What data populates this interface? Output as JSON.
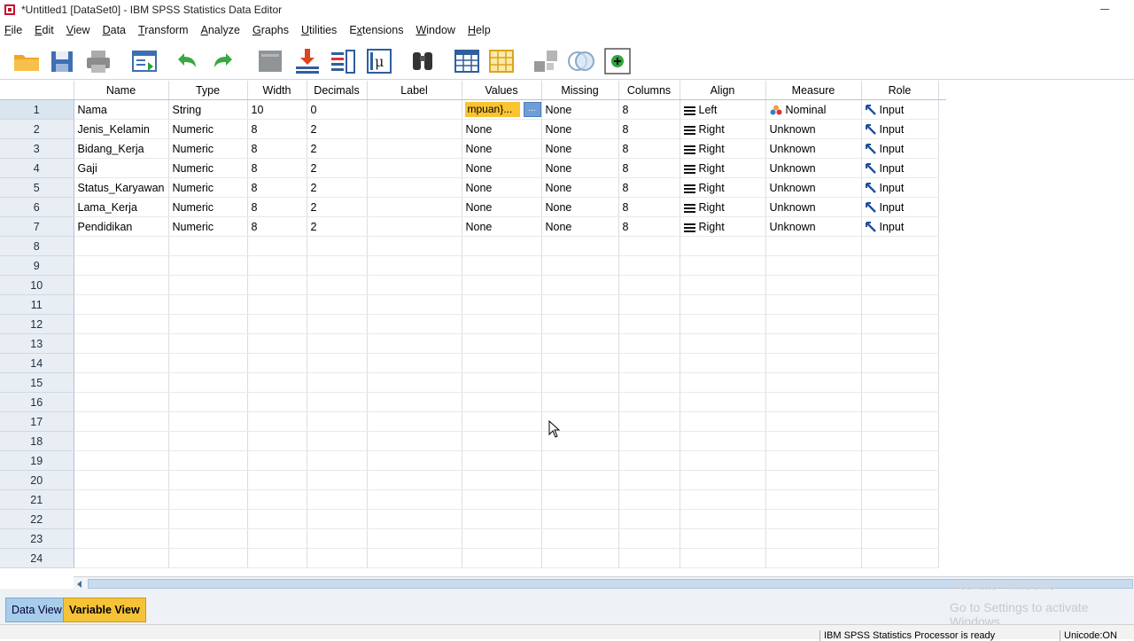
{
  "window": {
    "title": "*Untitled1 [DataSet0] - IBM SPSS Statistics Data Editor"
  },
  "menu": [
    {
      "label": "File",
      "mnemonic": "F"
    },
    {
      "label": "Edit",
      "mnemonic": "E"
    },
    {
      "label": "View",
      "mnemonic": "V"
    },
    {
      "label": "Data",
      "mnemonic": "D"
    },
    {
      "label": "Transform",
      "mnemonic": "T"
    },
    {
      "label": "Analyze",
      "mnemonic": "A"
    },
    {
      "label": "Graphs",
      "mnemonic": "G"
    },
    {
      "label": "Utilities",
      "mnemonic": "U"
    },
    {
      "label": "Extensions",
      "mnemonic": "x"
    },
    {
      "label": "Window",
      "mnemonic": "W"
    },
    {
      "label": "Help",
      "mnemonic": "H"
    }
  ],
  "toolbar": [
    "open-folder-icon",
    "save-icon",
    "print-icon",
    "dialog-recall-icon",
    "undo-icon",
    "redo-icon",
    "goto-case-icon",
    "goto-variable-icon",
    "variables-icon",
    "run-descriptives-icon",
    "find-icon",
    "insert-cases-icon",
    "insert-variable-icon",
    "split-file-icon",
    "value-labels-icon",
    "use-sets-icon"
  ],
  "grid": {
    "columns": [
      "Name",
      "Type",
      "Width",
      "Decimals",
      "Label",
      "Values",
      "Missing",
      "Columns",
      "Align",
      "Measure",
      "Role"
    ],
    "rows": [
      {
        "n": "1",
        "name": "Nama",
        "type": "String",
        "width": "10",
        "decimals": "0",
        "label": "",
        "values": "mpuan}...",
        "missing": "None",
        "columns": "8",
        "align": "Left",
        "measure": "Nominal",
        "role": "Input"
      },
      {
        "n": "2",
        "name": "Jenis_Kelamin",
        "type": "Numeric",
        "width": "8",
        "decimals": "2",
        "label": "",
        "values": "None",
        "missing": "None",
        "columns": "8",
        "align": "Right",
        "measure": "Unknown",
        "role": "Input"
      },
      {
        "n": "3",
        "name": "Bidang_Kerja",
        "type": "Numeric",
        "width": "8",
        "decimals": "2",
        "label": "",
        "values": "None",
        "missing": "None",
        "columns": "8",
        "align": "Right",
        "measure": "Unknown",
        "role": "Input"
      },
      {
        "n": "4",
        "name": "Gaji",
        "type": "Numeric",
        "width": "8",
        "decimals": "2",
        "label": "",
        "values": "None",
        "missing": "None",
        "columns": "8",
        "align": "Right",
        "measure": "Unknown",
        "role": "Input"
      },
      {
        "n": "5",
        "name": "Status_Karyawan",
        "type": "Numeric",
        "width": "8",
        "decimals": "2",
        "label": "",
        "values": "None",
        "missing": "None",
        "columns": "8",
        "align": "Right",
        "measure": "Unknown",
        "role": "Input"
      },
      {
        "n": "6",
        "name": "Lama_Kerja",
        "type": "Numeric",
        "width": "8",
        "decimals": "2",
        "label": "",
        "values": "None",
        "missing": "None",
        "columns": "8",
        "align": "Right",
        "measure": "Unknown",
        "role": "Input"
      },
      {
        "n": "7",
        "name": "Pendidikan",
        "type": "Numeric",
        "width": "8",
        "decimals": "2",
        "label": "",
        "values": "None",
        "missing": "None",
        "columns": "8",
        "align": "Right",
        "measure": "Unknown",
        "role": "Input"
      }
    ],
    "empty_row_numbers": [
      "8",
      "9",
      "10",
      "11",
      "12",
      "13",
      "14",
      "15",
      "16",
      "17",
      "18",
      "19",
      "20",
      "21",
      "22",
      "23",
      "24"
    ],
    "values_button": "..."
  },
  "tabs": {
    "data_view": "Data View",
    "variable_view": "Variable View"
  },
  "watermark": {
    "line1": "Activate Windows",
    "line2": "Go to Settings to activate Windows."
  },
  "status": {
    "processor": "IBM SPSS Statistics Processor is ready",
    "unicode": "Unicode:ON"
  },
  "colors": {
    "selected_cell": "#f9c332",
    "active_tab": "#f6c338",
    "data_tab": "#a7cdeb",
    "row_header": "#e9eef4"
  }
}
